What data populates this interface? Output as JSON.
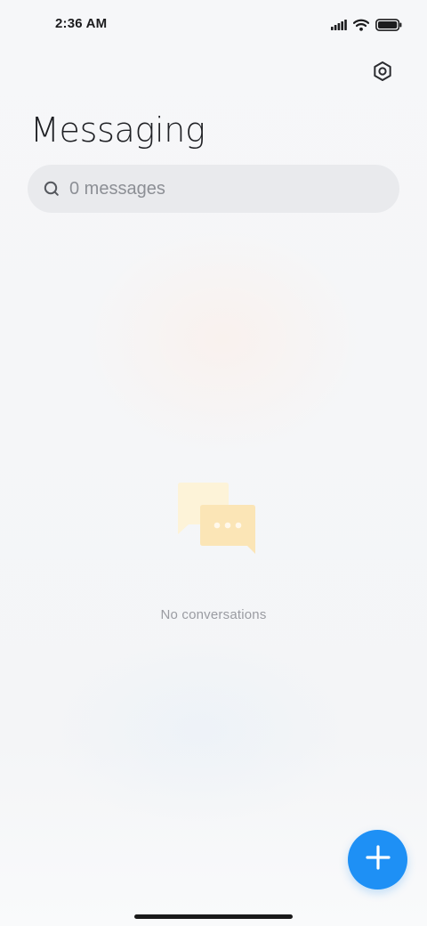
{
  "status_bar": {
    "time": "2:36 AM",
    "icons": [
      "signal-icon",
      "wifi-icon",
      "battery-icon"
    ],
    "battery_level": 1.0
  },
  "header": {
    "title": "Messaging",
    "settings_icon": "settings-icon"
  },
  "search": {
    "icon": "search-icon",
    "placeholder": "0 messages"
  },
  "empty_state": {
    "icon": "chat-bubbles-icon",
    "text": "No conversations"
  },
  "fab": {
    "icon": "plus-icon",
    "color": "#1e90f5"
  },
  "colors": {
    "accent": "#1e90f5",
    "illustration_light": "#fdf3d8",
    "illustration_dark": "#fbe5b6"
  }
}
